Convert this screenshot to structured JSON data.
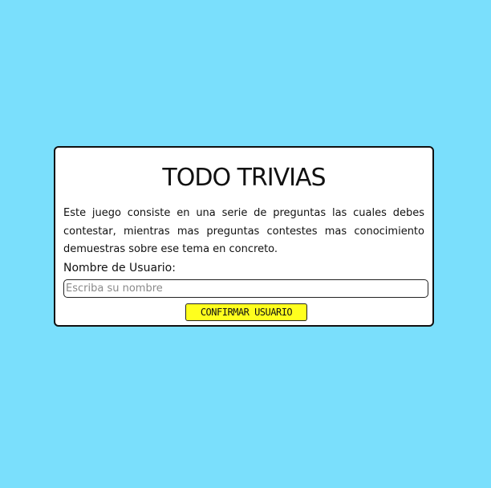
{
  "page": {
    "background_color": "#7adffc"
  },
  "card": {
    "title": "TODO TRIVIAS",
    "description": "Este juego consiste en una serie de preguntas las cuales debes contestar, mientras mas preguntas contestes mas conocimiento demuestras sobre ese tema en concreto.",
    "username_label": "Nombre de Usuario:",
    "username_input": {
      "value": "",
      "placeholder": "Escriba su nombre"
    },
    "confirm_button_label": "CONFIRMAR USUARIO",
    "confirm_button_color": "#ffff1e"
  }
}
